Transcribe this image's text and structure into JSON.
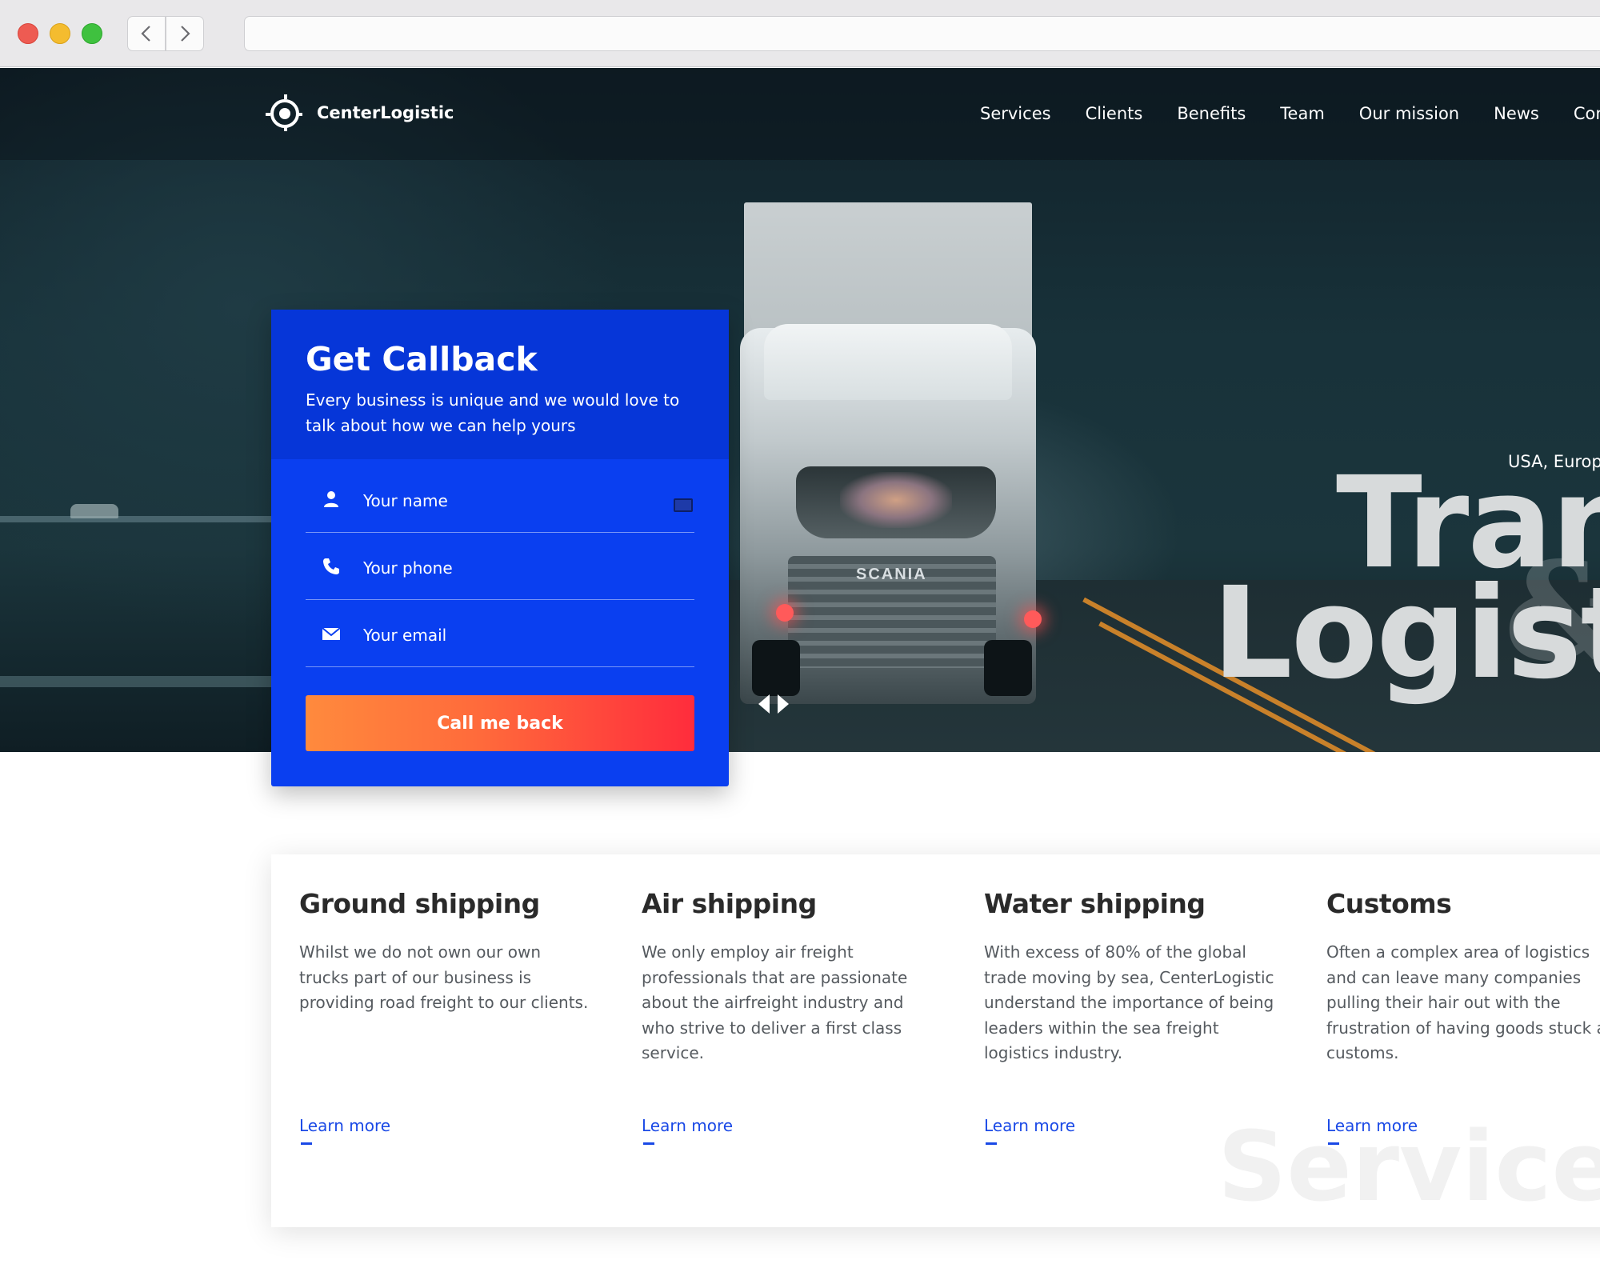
{
  "browser": {
    "back_icon": "chevron-left-icon",
    "forward_icon": "chevron-right-icon",
    "address": ""
  },
  "site": {
    "brand": "CenterLogistic",
    "nav": [
      "Services",
      "Clients",
      "Benefits",
      "Team",
      "Our mission",
      "News",
      "Contact"
    ]
  },
  "hero": {
    "subtitle": "USA, Europe",
    "title_line1": "Trans",
    "title_line2": "Logistic",
    "truck_badge": "SCANIA"
  },
  "callback": {
    "title": "Get Callback",
    "description": "Every business is unique and we would love to talk about how we can help yours",
    "name_placeholder": "Your name",
    "phone_placeholder": "Your phone",
    "email_placeholder": "Your email",
    "button": "Call me back"
  },
  "services": {
    "watermark": "Services",
    "items": [
      {
        "title": "Ground shipping",
        "text": "Whilst we do not own our own trucks part of our business is providing road freight to our clients.",
        "link": "Learn more"
      },
      {
        "title": "Air shipping",
        "text": "We only employ air freight professionals that are passionate about the airfreight industry and who strive to deliver a first class service.",
        "link": "Learn more"
      },
      {
        "title": "Water shipping",
        "text": "With excess of 80% of the global trade moving by sea, CenterLogistic understand the importance of being leaders within the sea freight logistics industry.",
        "link": "Learn more"
      },
      {
        "title": "Customs",
        "text": "Often a complex area of logistics and can leave many companies pulling their hair out with the frustration of having goods stuck at customs.",
        "link": "Learn more"
      }
    ]
  },
  "colors": {
    "form_blue": "#0a3ff0",
    "form_header_blue": "#0636d8",
    "cta_start": "#ff8a3d",
    "cta_end": "#ff2c3c",
    "link_blue": "#1a49e6"
  }
}
